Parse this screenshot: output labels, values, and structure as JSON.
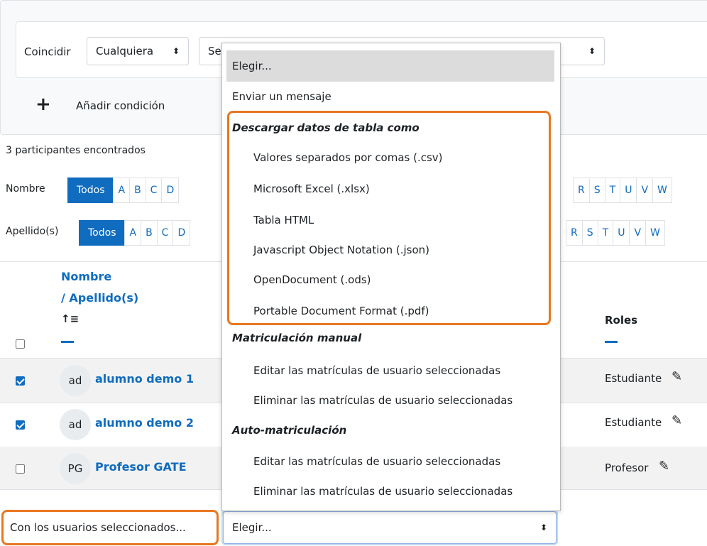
{
  "filter": {
    "match_label": "Coincidir",
    "match_value": "Cualquiera",
    "select_value": "Se",
    "add_condition": "Añadir condición"
  },
  "participants_found": "3 participantes encontrados",
  "initials": {
    "first_label": "Nombre",
    "last_label": "Apellido(s)",
    "all": "Todos",
    "letters_first_left": [
      "A",
      "B",
      "C",
      "D"
    ],
    "letters_last_left": [
      "A",
      "B",
      "C",
      "D"
    ],
    "letters_first_right": [
      "R",
      "S",
      "T",
      "U",
      "V",
      "W"
    ],
    "letters_last_right": [
      "R",
      "S",
      "T",
      "U",
      "V",
      "W"
    ]
  },
  "table": {
    "col_name": "Nombre",
    "col_lastname": "/ Apellido(s)",
    "sort_icon": "↑≡",
    "col_roles": "Roles",
    "rows": [
      {
        "initials": "ad",
        "name": "alumno demo 1",
        "role": "Estudiante",
        "checked": true
      },
      {
        "initials": "ad",
        "name": "alumno demo 2",
        "role": "Estudiante",
        "checked": true
      },
      {
        "initials": "PG",
        "name": "Profesor GATE",
        "role": "Profesor",
        "checked": false
      }
    ]
  },
  "bulk": {
    "label": "Con los usuarios seleccionados...",
    "select_value": "Elegir..."
  },
  "dropdown": {
    "selected": "Elegir...",
    "send_message": "Enviar un mensaje",
    "group_download": "Descargar datos de tabla como",
    "download_options": [
      "Valores separados por comas (.csv)",
      "Microsoft Excel (.xlsx)",
      "Tabla HTML",
      "Javascript Object Notation (.json)",
      "OpenDocument (.ods)",
      "Portable Document Format (.pdf)"
    ],
    "group_manual": "Matriculación manual",
    "manual_options": [
      "Editar las matrículas de usuario seleccionadas",
      "Eliminar las matrículas de usuario seleccionadas"
    ],
    "group_self": "Auto-matriculación",
    "self_options": [
      "Editar las matrículas de usuario seleccionadas",
      "Eliminar las matrículas de usuario seleccionadas"
    ]
  },
  "colors": {
    "link": "#0f6cbf",
    "highlight": "#e87722"
  }
}
